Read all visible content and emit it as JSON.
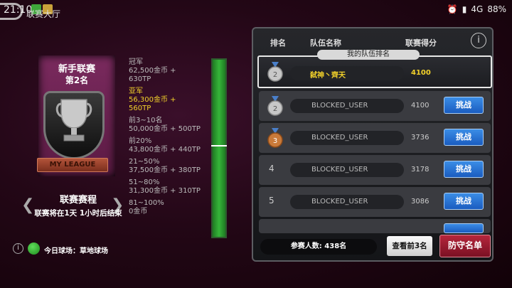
{
  "statusbar": {
    "time": "21:10",
    "title": "联赛大厅",
    "network": "4G",
    "battery": "88%"
  },
  "league": {
    "name": "新手联赛",
    "rank": "第2名",
    "plaque": "MY LEAGUE",
    "schedule_title": "联赛赛程",
    "schedule_text": "联赛将在1天 1小时后结束"
  },
  "rewards": [
    {
      "title": "冠军",
      "line1": "62,500金币 +",
      "line2": "630TP",
      "highlight": false
    },
    {
      "title": "亚军",
      "line1": "56,300金币 +",
      "line2": "560TP",
      "highlight": true
    },
    {
      "title": "前3~10名",
      "line1": "50,000金币 + 500TP",
      "line2": "",
      "highlight": false
    },
    {
      "title": "前20%",
      "line1": "43,800金币 + 440TP",
      "line2": "",
      "highlight": false
    },
    {
      "title": "21~50%",
      "line1": "37,500金币 + 380TP",
      "line2": "",
      "highlight": false
    },
    {
      "title": "51~80%",
      "line1": "31,300金币 + 310TP",
      "line2": "",
      "highlight": false
    },
    {
      "title": "81~100%",
      "line1": "0金币",
      "line2": "",
      "highlight": false
    }
  ],
  "today_field": "今日球场：草地球场",
  "board": {
    "headers": {
      "rank": "排名",
      "team": "队伍名称",
      "score": "联赛得分"
    },
    "my_tag": "我的队伍排名",
    "my_row": {
      "rank": "2",
      "name": "弑神丶齊天",
      "score": "4100"
    },
    "rows": [
      {
        "rank": "2",
        "name": "BLOCKED_USER",
        "score": "4100",
        "medal": "silver"
      },
      {
        "rank": "3",
        "name": "BLOCKED_USER",
        "score": "3736",
        "medal": "bronze"
      },
      {
        "rank": "4",
        "name": "BLOCKED_USER",
        "score": "3178",
        "medal": ""
      },
      {
        "rank": "5",
        "name": "BLOCKED_USER",
        "score": "3086",
        "medal": ""
      }
    ],
    "challenge_label": "挑战",
    "participants": "参赛人数: 438名",
    "top3_label": "查看前3名",
    "defense_label": "防守名单"
  },
  "colors": {
    "highlight": "#f2d12a",
    "challenge": "#2a74d6",
    "defense": "#9a1a30"
  }
}
